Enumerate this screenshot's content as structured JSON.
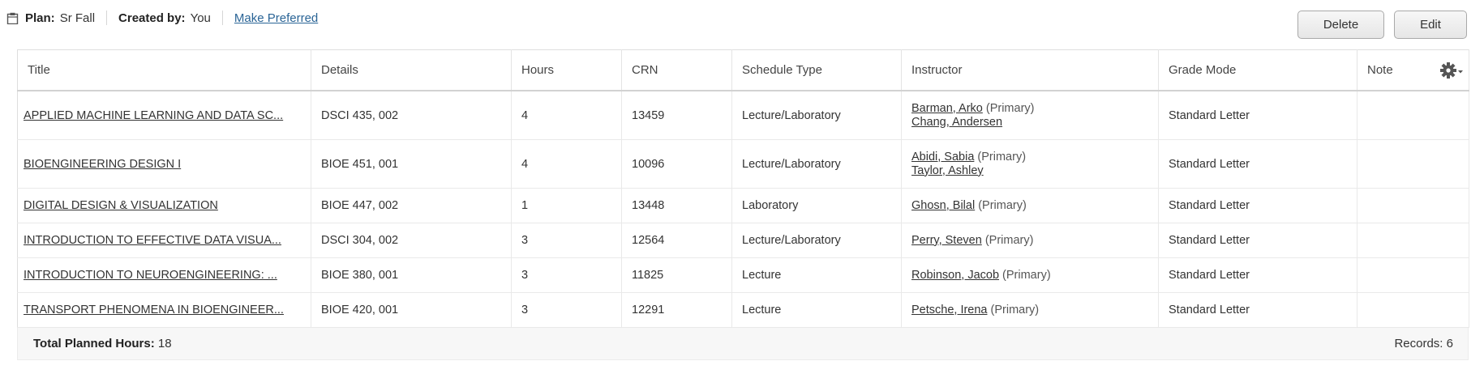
{
  "plan_header": {
    "plan_label": "Plan:",
    "plan_value": "Sr Fall",
    "created_label": "Created by:",
    "created_value": "You",
    "make_preferred": "Make Preferred"
  },
  "actions": {
    "delete_label": "Delete",
    "edit_label": "Edit"
  },
  "columns": [
    "Title",
    "Details",
    "Hours",
    "CRN",
    "Schedule Type",
    "Instructor",
    "Grade Mode",
    "Note"
  ],
  "rows": [
    {
      "title": "APPLIED MACHINE LEARNING AND DATA SC...",
      "details": "DSCI 435, 002",
      "hours": "4",
      "crn": "13459",
      "schedule_type": "Lecture/Laboratory",
      "instructors": [
        {
          "name": "Barman, Arko",
          "role": "(Primary)"
        },
        {
          "name": "Chang, Andersen",
          "role": ""
        }
      ],
      "grade_mode": "Standard Letter",
      "note": ""
    },
    {
      "title": "BIOENGINEERING DESIGN I",
      "details": "BIOE 451, 001",
      "hours": "4",
      "crn": "10096",
      "schedule_type": "Lecture/Laboratory",
      "instructors": [
        {
          "name": "Abidi, Sabia",
          "role": "(Primary)"
        },
        {
          "name": "Taylor, Ashley",
          "role": ""
        }
      ],
      "grade_mode": "Standard Letter",
      "note": ""
    },
    {
      "title": "DIGITAL DESIGN & VISUALIZATION",
      "details": "BIOE 447, 002",
      "hours": "1",
      "crn": "13448",
      "schedule_type": "Laboratory",
      "instructors": [
        {
          "name": "Ghosn, Bilal",
          "role": "(Primary)"
        }
      ],
      "grade_mode": "Standard Letter",
      "note": ""
    },
    {
      "title": "INTRODUCTION TO EFFECTIVE DATA VISUA...",
      "details": "DSCI 304, 002",
      "hours": "3",
      "crn": "12564",
      "schedule_type": "Lecture/Laboratory",
      "instructors": [
        {
          "name": "Perry, Steven",
          "role": "(Primary)"
        }
      ],
      "grade_mode": "Standard Letter",
      "note": ""
    },
    {
      "title": "INTRODUCTION TO NEUROENGINEERING: ...",
      "details": "BIOE 380, 001",
      "hours": "3",
      "crn": "11825",
      "schedule_type": "Lecture",
      "instructors": [
        {
          "name": "Robinson, Jacob",
          "role": "(Primary)"
        }
      ],
      "grade_mode": "Standard Letter",
      "note": ""
    },
    {
      "title": "TRANSPORT PHENOMENA IN BIOENGINEER...",
      "details": "BIOE 420, 001",
      "hours": "3",
      "crn": "12291",
      "schedule_type": "Lecture",
      "instructors": [
        {
          "name": "Petsche, Irena",
          "role": "(Primary)"
        }
      ],
      "grade_mode": "Standard Letter",
      "note": ""
    }
  ],
  "footer": {
    "total_label": "Total Planned Hours:",
    "total_value": "18",
    "records_text": "Records: 6"
  },
  "icons": {
    "plan": "clipboard-icon",
    "settings": "gear-icon"
  },
  "colors": {
    "link": "#2a6496",
    "footer_bg": "#f7f7f7",
    "button_border": "#a9a9a9"
  }
}
